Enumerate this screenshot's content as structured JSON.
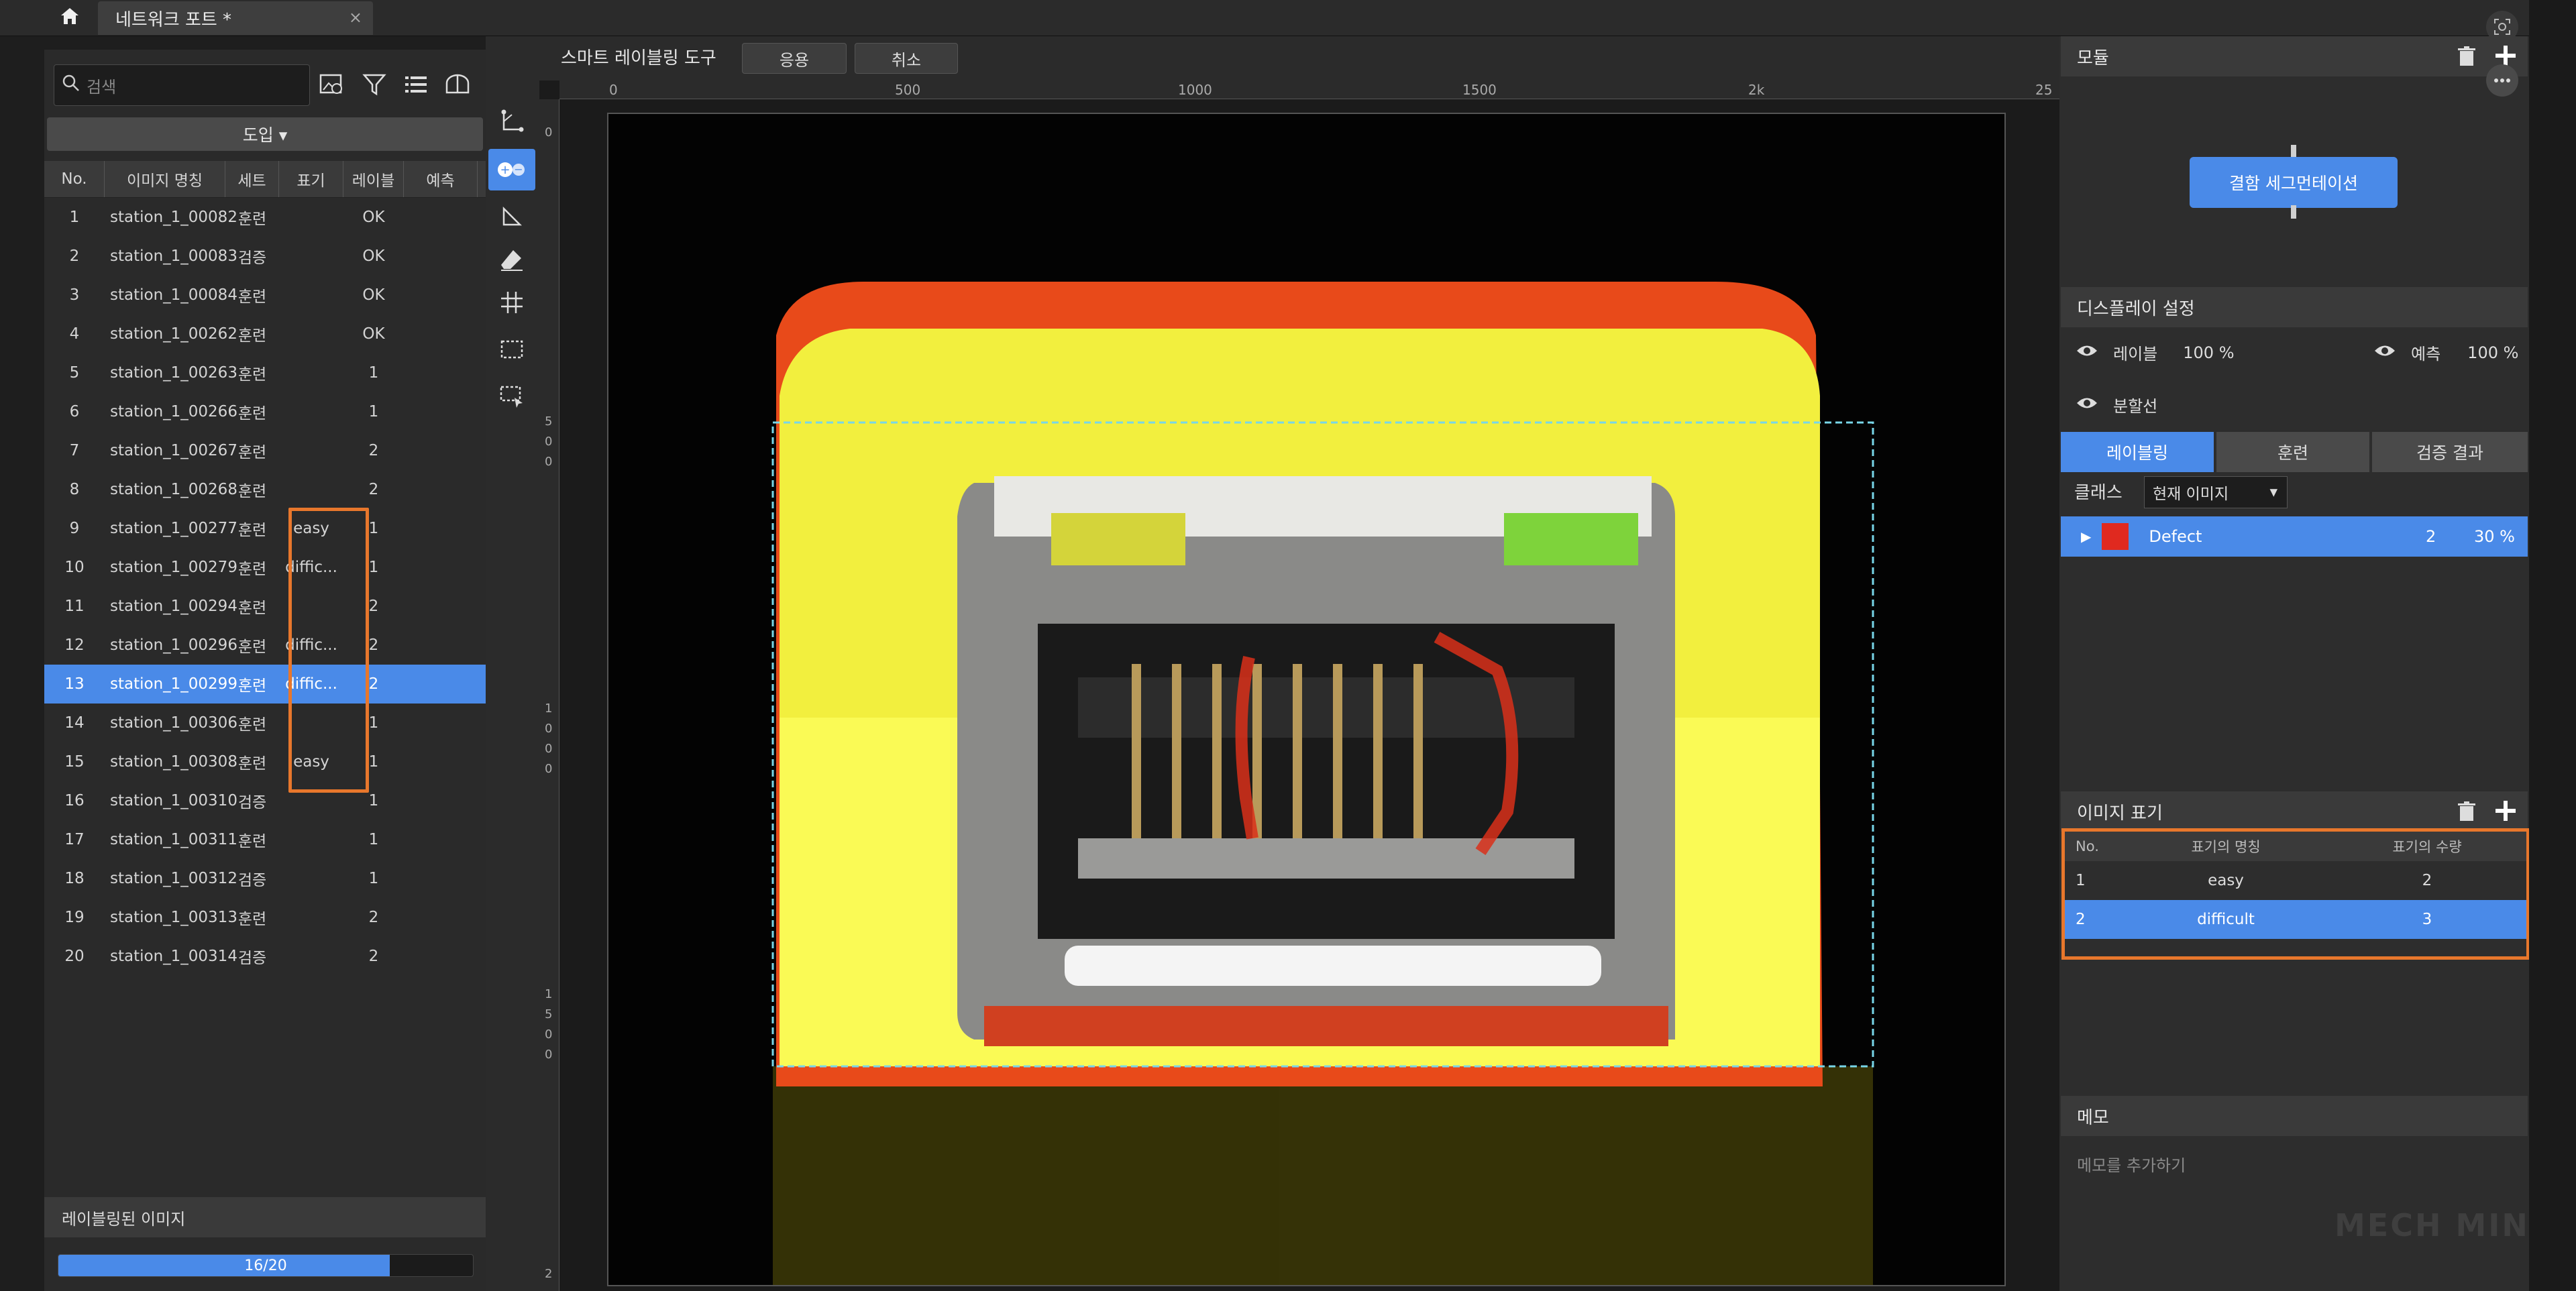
{
  "tab": {
    "title": "네트워크 포트 *",
    "close": "×"
  },
  "left": {
    "search_placeholder": "검색",
    "import_label": "도입 ▾",
    "columns": [
      "No.",
      "이미지 명칭",
      "세트",
      "표기",
      "레이블",
      "예측"
    ],
    "rows": [
      {
        "no": "1",
        "name": "station_1_00082",
        "set": "훈련",
        "tag": "",
        "label": "OK",
        "pred": ""
      },
      {
        "no": "2",
        "name": "station_1_00083",
        "set": "검증",
        "tag": "",
        "label": "OK",
        "pred": ""
      },
      {
        "no": "3",
        "name": "station_1_00084",
        "set": "훈련",
        "tag": "",
        "label": "OK",
        "pred": ""
      },
      {
        "no": "4",
        "name": "station_1_00262",
        "set": "훈련",
        "tag": "",
        "label": "OK",
        "pred": ""
      },
      {
        "no": "5",
        "name": "station_1_00263",
        "set": "훈련",
        "tag": "",
        "label": "1",
        "pred": ""
      },
      {
        "no": "6",
        "name": "station_1_00266",
        "set": "훈련",
        "tag": "",
        "label": "1",
        "pred": ""
      },
      {
        "no": "7",
        "name": "station_1_00267",
        "set": "훈련",
        "tag": "",
        "label": "2",
        "pred": ""
      },
      {
        "no": "8",
        "name": "station_1_00268",
        "set": "훈련",
        "tag": "",
        "label": "2",
        "pred": ""
      },
      {
        "no": "9",
        "name": "station_1_00277",
        "set": "훈련",
        "tag": "easy",
        "label": "1",
        "pred": ""
      },
      {
        "no": "10",
        "name": "station_1_00279",
        "set": "훈련",
        "tag": "diffic...",
        "label": "1",
        "pred": ""
      },
      {
        "no": "11",
        "name": "station_1_00294",
        "set": "훈련",
        "tag": "",
        "label": "2",
        "pred": ""
      },
      {
        "no": "12",
        "name": "station_1_00296",
        "set": "훈련",
        "tag": "diffic...",
        "label": "2",
        "pred": ""
      },
      {
        "no": "13",
        "name": "station_1_00299",
        "set": "훈련",
        "tag": "diffic...",
        "label": "2",
        "pred": ""
      },
      {
        "no": "14",
        "name": "station_1_00306",
        "set": "훈련",
        "tag": "",
        "label": "1",
        "pred": ""
      },
      {
        "no": "15",
        "name": "station_1_00308",
        "set": "훈련",
        "tag": "easy",
        "label": "1",
        "pred": ""
      },
      {
        "no": "16",
        "name": "station_1_00310",
        "set": "검증",
        "tag": "",
        "label": "1",
        "pred": ""
      },
      {
        "no": "17",
        "name": "station_1_00311",
        "set": "훈련",
        "tag": "",
        "label": "1",
        "pred": ""
      },
      {
        "no": "18",
        "name": "station_1_00312",
        "set": "검증",
        "tag": "",
        "label": "1",
        "pred": ""
      },
      {
        "no": "19",
        "name": "station_1_00313",
        "set": "훈련",
        "tag": "",
        "label": "2",
        "pred": ""
      },
      {
        "no": "20",
        "name": "station_1_00314",
        "set": "검증",
        "tag": "",
        "label": "2",
        "pred": ""
      }
    ],
    "selected_row": 13,
    "labeled_title": "레이블링된 이미지",
    "progress_text": "16/20",
    "progress_fraction": 0.8
  },
  "toolbar": {
    "title": "스마트 레이블링 도구",
    "apply": "응용",
    "cancel": "취소"
  },
  "ruler": {
    "top_ticks": [
      "0",
      "500",
      "1000",
      "1500",
      "2k",
      "25"
    ],
    "left_ticks": [
      "0",
      "5\n0\n0",
      "1\n0\n0\n0",
      "1\n5\n0\n0",
      "2"
    ]
  },
  "right": {
    "module_title": "모듈",
    "module_node": "결함 세그먼테이션",
    "display_title": "디스플레이 설정",
    "display_label": "레이블",
    "display_label_pct": "100 %",
    "display_pred": "예측",
    "display_pred_pct": "100 %",
    "display_split": "분할선",
    "tabs": [
      "레이블링",
      "훈련",
      "검증 결과"
    ],
    "active_tab": 0,
    "class_label": "클래스",
    "class_select": "현재 이미지",
    "defect": {
      "name": "Defect",
      "count": "2",
      "pct": "30 %",
      "color": "#e0291f"
    },
    "tag_title": "이미지 표기",
    "tag_columns": [
      "No.",
      "표기의 명칭",
      "표기의 수량"
    ],
    "tags": [
      {
        "no": "1",
        "name": "easy",
        "count": "2"
      },
      {
        "no": "2",
        "name": "difficult",
        "count": "3"
      }
    ],
    "memo_title": "메모",
    "memo_placeholder": "메모를 추가하기"
  },
  "colors": {
    "accent": "#4a8ae8",
    "highlight": "#e8772c"
  },
  "watermark": "MECH MIND"
}
